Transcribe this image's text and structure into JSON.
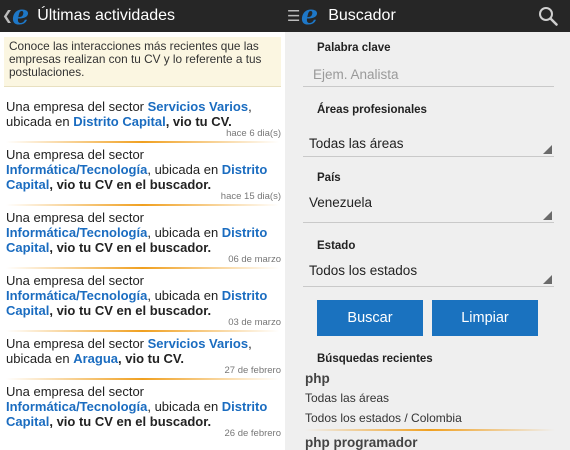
{
  "left": {
    "title": "Últimas actividades",
    "notice": "Conoce las interacciones más recientes que las empresas realizan con tu CV y lo referente a tus postulaciones.",
    "items": [
      {
        "prefix": "Una empresa del sector ",
        "sector": "Servicios Varios",
        "mid": ", ubicada en ",
        "location": "Distrito Capital",
        "action": ", vio tu CV.",
        "time": "hace 6 dia(s)"
      },
      {
        "prefix": "Una empresa del sector ",
        "sector": "Informática/Tecnología",
        "mid": ", ubicada en ",
        "location": "Distrito Capital",
        "action": ", vio tu CV en el buscador.",
        "time": "hace 15 dia(s)"
      },
      {
        "prefix": "Una empresa del sector ",
        "sector": "Informática/Tecnología",
        "mid": ", ubicada en ",
        "location": "Distrito Capital",
        "action": ", vio tu CV en el buscador.",
        "time": "06 de marzo"
      },
      {
        "prefix": "Una empresa del sector ",
        "sector": "Informática/Tecnología",
        "mid": ", ubicada en ",
        "location": "Distrito Capital",
        "action": ", vio tu CV en el buscador.",
        "time": "03 de marzo"
      },
      {
        "prefix": "Una empresa del sector ",
        "sector": "Servicios Varios",
        "mid": ", ubicada en ",
        "location": "Aragua",
        "action": ", vio tu CV.",
        "time": "27 de febrero"
      },
      {
        "prefix": "Una empresa del sector ",
        "sector": "Informática/Tecnología",
        "mid": ", ubicada en ",
        "location": "Distrito Capital",
        "action": ", vio tu CV en el buscador.",
        "time": "26 de febrero"
      }
    ]
  },
  "right": {
    "title": "Buscador",
    "keyword_label": "Palabra clave",
    "keyword_placeholder": "Ejem. Analista",
    "areas_label": "Áreas profesionales",
    "areas_value": "Todas las áreas",
    "country_label": "País",
    "country_value": "Venezuela",
    "state_label": "Estado",
    "state_value": "Todos los estados",
    "search_button": "Buscar",
    "clear_button": "Limpiar",
    "recent_label": "Búsquedas recientes",
    "recent": [
      {
        "query": "php",
        "area": "Todas las áreas",
        "location": "Todos los estados / Colombia"
      },
      {
        "query": "php programador"
      }
    ]
  },
  "icons": {
    "logo": "e",
    "back": "chevron-left-icon",
    "menu": "menu-icon",
    "search": "search-icon"
  },
  "colors": {
    "brand_blue": "#1a72bf",
    "accent_orange": "#f0a020",
    "bar": "#262626",
    "notice_bg": "#fbf6e1"
  }
}
